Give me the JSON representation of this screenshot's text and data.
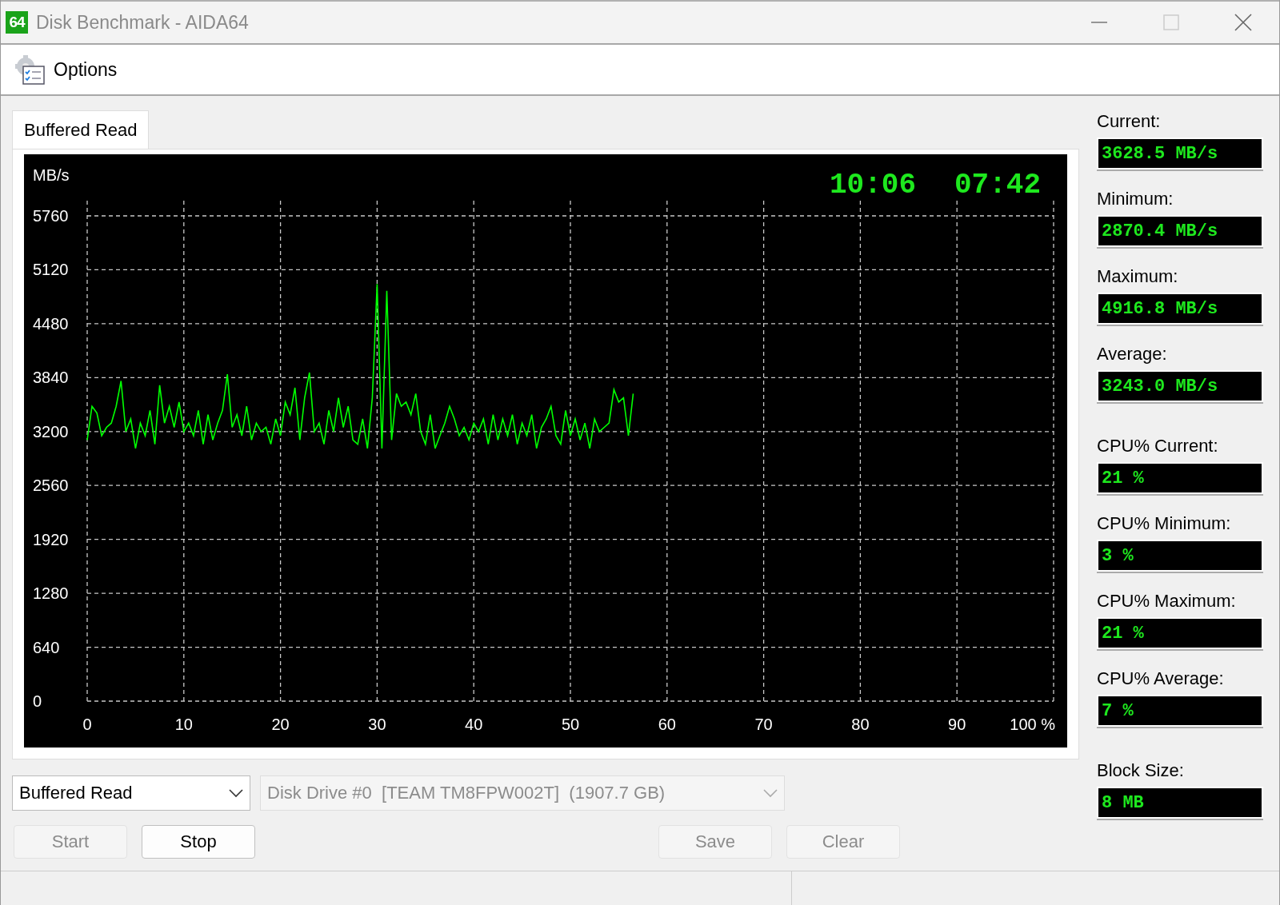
{
  "window": {
    "icon_label": "64",
    "title": "Disk Benchmark - AIDA64"
  },
  "menu": [
    {
      "label": "Options"
    }
  ],
  "tabs": [
    {
      "label": "Buffered Read",
      "selected": true
    }
  ],
  "chart": {
    "timers": [
      "10:06",
      "07:42"
    ],
    "chart_data": {
      "type": "line",
      "ylabel": "MB/s",
      "x": [
        0,
        0.5,
        1,
        1.5,
        2,
        2.5,
        3,
        3.5,
        4,
        4.5,
        5,
        5.5,
        6,
        6.5,
        7,
        7.5,
        8,
        8.5,
        9,
        9.5,
        10,
        10.5,
        11,
        11.5,
        12,
        12.5,
        13,
        13.5,
        14,
        14.5,
        15,
        15.5,
        16,
        16.5,
        17,
        17.5,
        18,
        18.5,
        19,
        19.5,
        20,
        20.5,
        21,
        21.5,
        22,
        22.5,
        23,
        23.5,
        24,
        24.5,
        25,
        25.5,
        26,
        26.5,
        27,
        27.5,
        28,
        28.5,
        29,
        29.5,
        30,
        30.5,
        31,
        31.5,
        32,
        32.5,
        33,
        33.5,
        34,
        34.5,
        35,
        35.5,
        36,
        36.5,
        37,
        37.5,
        38,
        38.5,
        39,
        39.5,
        40,
        40.5,
        41,
        41.5,
        42,
        42.5,
        43,
        43.5,
        44,
        44.5,
        45,
        45.5,
        46,
        46.5,
        47,
        47.5,
        48,
        48.5,
        49,
        49.5,
        50,
        50.5,
        51,
        51.5,
        52,
        52.5,
        53,
        53.5,
        54,
        54.5,
        55,
        55.5,
        56,
        56.5
      ],
      "series": [
        {
          "color": "#00ff00",
          "values": [
            3100,
            3500,
            3420,
            3150,
            3250,
            3300,
            3500,
            3800,
            3200,
            3350,
            3000,
            3300,
            3150,
            3450,
            3050,
            3750,
            3300,
            3500,
            3250,
            3550,
            3200,
            3300,
            3150,
            3450,
            3050,
            3400,
            3100,
            3300,
            3450,
            3880,
            3250,
            3400,
            3150,
            3500,
            3100,
            3300,
            3200,
            3250,
            3050,
            3350,
            3150,
            3550,
            3400,
            3720,
            3100,
            3600,
            3900,
            3200,
            3300,
            3050,
            3450,
            3200,
            3600,
            3250,
            3500,
            3100,
            3050,
            3350,
            3000,
            3600,
            4950,
            3000,
            4870,
            3100,
            3650,
            3500,
            3550,
            3400,
            3650,
            3200,
            3050,
            3400,
            3000,
            3150,
            3300,
            3500,
            3350,
            3150,
            3250,
            3100,
            3300,
            3200,
            3350,
            3050,
            3400,
            3100,
            3350,
            3150,
            3400,
            3050,
            3300,
            3150,
            3400,
            3000,
            3250,
            3350,
            3500,
            3150,
            3050,
            3450,
            3150,
            3350,
            3100,
            3300,
            3000,
            3350,
            3200,
            3250,
            3300,
            3700,
            3550,
            3600,
            3150,
            3650
          ]
        }
      ],
      "xlim": [
        0,
        100
      ],
      "ylim": [
        0,
        5760
      ],
      "grid": true,
      "xticks": [
        0,
        10,
        20,
        30,
        40,
        50,
        60,
        70,
        80,
        90,
        {
          "value": 100,
          "label": "100 %"
        }
      ],
      "yticks": [
        0,
        640,
        1280,
        1920,
        2560,
        3200,
        3840,
        4480,
        5120,
        5760
      ]
    }
  },
  "speed_stats": [
    {
      "label": "Current:",
      "value": "3628.5 MB/s"
    },
    {
      "label": "Minimum:",
      "value": "2870.4 MB/s"
    },
    {
      "label": "Maximum:",
      "value": "4916.8 MB/s"
    },
    {
      "label": "Average:",
      "value": "3243.0 MB/s"
    }
  ],
  "cpu_stats": [
    {
      "label": "CPU% Current:",
      "value": "21 %"
    },
    {
      "label": "CPU% Minimum:",
      "value": "3 %"
    },
    {
      "label": "CPU% Maximum:",
      "value": "21 %"
    },
    {
      "label": "CPU% Average:",
      "value": "7 %"
    }
  ],
  "block_stats": [
    {
      "label": "Block Size:",
      "value": "8 MB"
    }
  ],
  "test_select": {
    "value": "Buffered Read",
    "disabled": false
  },
  "drive_select": {
    "value": "Disk Drive #0  [TEAM TM8FPW002T]  (1907.7 GB)",
    "disabled": true
  },
  "buttons": [
    {
      "label": "Start",
      "disabled": true
    },
    {
      "label": "Stop",
      "disabled": false
    },
    {
      "label": "Save",
      "disabled": true
    },
    {
      "label": "Clear",
      "disabled": true
    }
  ]
}
